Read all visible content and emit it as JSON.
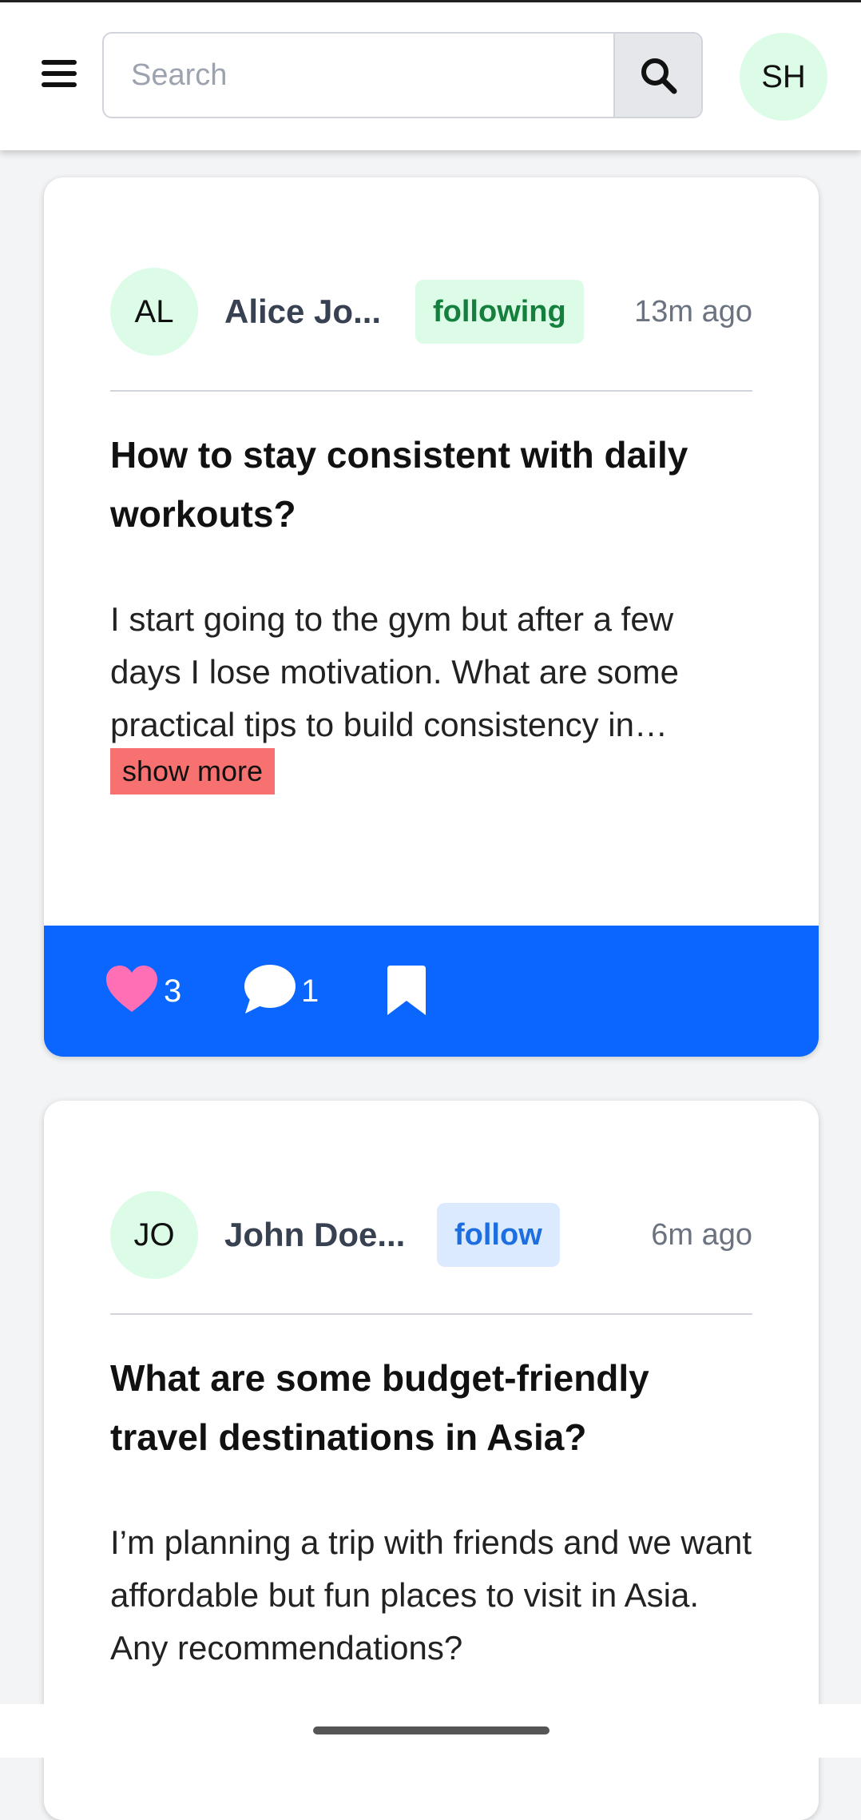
{
  "header": {
    "search_placeholder": "Search",
    "user_initials": "SH"
  },
  "posts": [
    {
      "initials": "AL",
      "author": "Alice Jo...",
      "follow_label": "following",
      "time": "13m ago",
      "title": "How to stay consistent with daily workouts?",
      "body": "I start going to the gym but after a few days I lose motivation. What are some practical tips to build consistency in…",
      "show_more": "show more",
      "likes": "3",
      "comments": "1"
    },
    {
      "initials": "JO",
      "author": "John Doe...",
      "follow_label": "follow",
      "time": "6m ago",
      "title": "What are some budget-friendly travel destinations in Asia?",
      "body": "I’m planning a trip with friends and we want affordable but fun places to visit in Asia. Any recommendations?"
    }
  ],
  "colors": {
    "action_bar": "#0a66ff",
    "like_heart": "#ff6fb5",
    "following_bg": "#dcfce7",
    "follow_bg": "#dbeafe",
    "show_more_bg": "#f87171"
  },
  "icons": [
    "menu-icon",
    "search-icon",
    "heart-icon",
    "comment-icon",
    "bookmark-icon"
  ]
}
